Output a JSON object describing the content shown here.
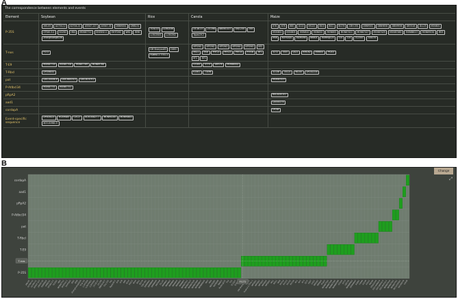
{
  "panels": {
    "a": "A",
    "b": "B"
  },
  "table": {
    "title": "The correspondence between elements and events",
    "headers": [
      "Element",
      "Soybean",
      "Rice",
      "Canola",
      "Maize"
    ],
    "rows": [
      {
        "element": "P-35S",
        "soybean": [
          "260-05",
          "A2704-12",
          "A2704-21",
          "A5547-127",
          "A5547-35",
          "DBN9004",
          "GMB151",
          "GTS40-3-2",
          "GG262",
          "HB4",
          "MON87712",
          "SHZD32-1",
          "SYHT0H2",
          "W62",
          "W98",
          "Zhonghuang6106"
        ],
        "rice": [
          "7Crp-10",
          "LLRICE06",
          "LLRICE601",
          "LLRICE62"
        ],
        "canola": [
          "23-18-17",
          "23-198",
          "88050-027",
          "Oxy-235",
          "T45",
          "Topas19-2"
        ],
        "maize": [
          "676",
          "678",
          "680",
          "4114",
          "59122",
          "Bt10",
          "Bt11",
          "Bt176",
          "CBH-351",
          "DBN9501",
          "DBN9858",
          "DBN9936",
          "DBT418",
          "DLL25",
          "MON801",
          "MON802",
          "MON809",
          "MON810",
          "MON832",
          "MON863",
          "MON87411",
          "MON87427",
          "MON87429",
          "MON87460",
          "MON88017",
          "MON89034",
          "MS3",
          "MS6",
          "MZHG0JG",
          "MZIR098",
          "NK603",
          "Ruifeng125",
          "T14",
          "T25",
          "TC1507",
          "TC6275"
        ]
      },
      {
        "element": "T-nos",
        "soybean": [
          "FG72"
        ],
        "rice": [
          "GM Shanyou63",
          "G6H1",
          "Huahui-1 TT51-1"
        ],
        "canola": [
          "MPS961",
          "MPS962",
          "MPS963",
          "MPS964",
          "MPS965",
          "MS1",
          "MS11",
          "MS8",
          "PHY14",
          "PHY23",
          "PHY35",
          "PHY36",
          "RF1",
          "RF2",
          "RF3"
        ],
        "maize": [
          "3272",
          "5307",
          "GA21",
          "MIR162",
          "MIR604",
          "PY203"
        ]
      },
      {
        "element": "T-E9",
        "soybean": [
          "MON87705",
          "MON87708",
          "MON87769",
          "MON89788"
        ],
        "rice": [],
        "canola": [
          "GT200",
          "GT73",
          "LBFLFK",
          "MON88302"
        ],
        "maize": []
      },
      {
        "element": "T-Rbcl",
        "soybean": [
          "DP356043"
        ],
        "rice": [],
        "canola": [
          "61061",
          "73496"
        ],
        "maize": [
          "32138",
          "33121",
          "98140",
          "DP202216"
        ]
      },
      {
        "element": "pat",
        "soybean": [
          "DAS-44406-6",
          "DAS-68416-4",
          "DAS-81419-2"
        ],
        "rice": [],
        "canola": [],
        "maize": [
          "MON87419"
        ]
      },
      {
        "element": "P-Atlbcl34",
        "soybean": [
          "MON87701",
          "MON87751"
        ],
        "rice": [],
        "canola": [],
        "maize": []
      },
      {
        "element": "pRpA2",
        "soybean": [],
        "rice": [],
        "canola": [],
        "maize": [
          "BVLA430101"
        ]
      },
      {
        "element": "aad1",
        "soybean": [],
        "rice": [],
        "canola": [],
        "maize": [
          "DAS40278"
        ]
      },
      {
        "element": "cordapA",
        "soybean": [],
        "rice": [],
        "canola": [],
        "maize": [
          "LY038"
        ]
      },
      {
        "element": "Event-specific sequence",
        "soybean": [
          "DP305423",
          "HCEM485",
          "CV127",
          "BGH-00827-7",
          "MON94100",
          "MON94643",
          "XCO-01981-5"
        ],
        "rice": [],
        "canola": [],
        "maize": []
      }
    ]
  },
  "chart": {
    "change_label": "Change",
    "expand_icon": "resize-icon",
    "tooltip_label": "T-nos",
    "tooltip_x_label": "FG72",
    "accent_color": "#1e9e1e",
    "bg_color": "#3e433d",
    "plot_color": "#6f7c6f"
  },
  "chart_data": {
    "type": "heatmap",
    "y_categories": [
      "P-35S",
      "T-nos",
      "T-E9",
      "T-Rbcl",
      "pat",
      "P-Atlbcl34",
      "pRpA2",
      "aad1",
      "cordapA"
    ],
    "x_categories": [
      "260-05",
      "A2704-12",
      "A2704-21",
      "A5547-127",
      "A5547-35",
      "DBN9004",
      "GMB151",
      "GTS40-3-2",
      "GG262",
      "HB4",
      "MON87712",
      "SHZD32-1",
      "SYHT0H2",
      "W62",
      "W98",
      "Zhonghuang6106",
      "7Crp-10",
      "LLRICE06",
      "LLRICE601",
      "LLRICE62",
      "23-18-17",
      "23-198",
      "88050-027",
      "Oxy-235",
      "T45",
      "Topas19-2",
      "676",
      "678",
      "680",
      "4114",
      "59122",
      "Bt10",
      "Bt11",
      "Bt176",
      "CBH-351",
      "DBN9501",
      "DBN9858",
      "DBN9936",
      "DBT418",
      "DLL25",
      "MON801",
      "MON802",
      "MON809",
      "MON810",
      "MON832",
      "MON863",
      "MON87411",
      "MON87427",
      "MON87429",
      "MON87460",
      "MON88017",
      "MON89034",
      "MS3",
      "MS6",
      "MZHG0JG",
      "MZIR098",
      "NK603",
      "Ruifeng125",
      "T14",
      "T25",
      "TC1507",
      "TC6275",
      "FG72",
      "GM Shanyou63",
      "G6H1",
      "Huahui-1 TT51-1",
      "MPS961",
      "MPS962",
      "MPS963",
      "MPS964",
      "MPS965",
      "MS1",
      "MS11",
      "MS8",
      "PHY14",
      "PHY23",
      "PHY35",
      "PHY36",
      "RF1",
      "RF2",
      "RF3",
      "3272",
      "5307",
      "GA21",
      "MIR162",
      "MIR604",
      "PY203",
      "MON87705",
      "MON87708",
      "MON87769",
      "MON89788",
      "GT200",
      "GT73",
      "LBFLFK",
      "MON88302",
      "DP356043",
      "61061",
      "73496",
      "32138",
      "33121",
      "98140",
      "DP202216",
      "DAS-44406-6",
      "DAS-68416-4",
      "DAS-81419-2",
      "MON87419",
      "MON87701",
      "MON87751",
      "BVLA430101",
      "DAS40278",
      "LY038"
    ],
    "segments": [
      62,
      25,
      8,
      7,
      4,
      2,
      1,
      1,
      1
    ]
  }
}
